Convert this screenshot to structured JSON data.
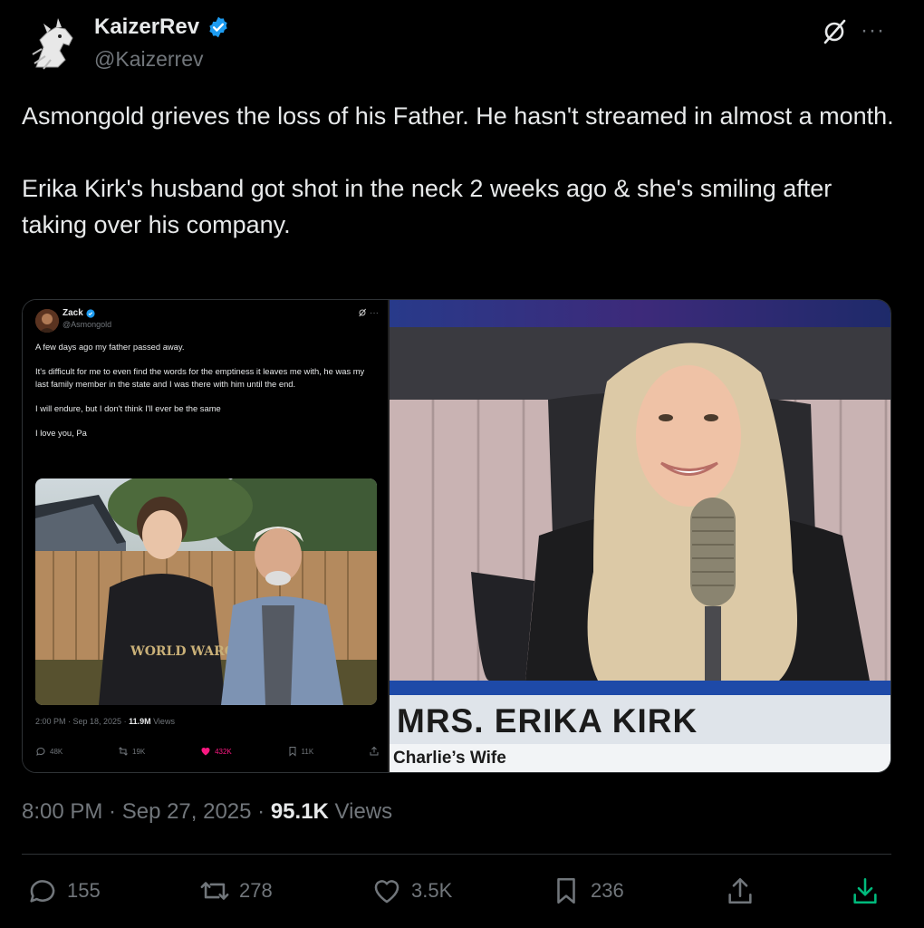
{
  "post": {
    "author": {
      "display_name": "KaizerRev",
      "handle": "@Kaizerrev",
      "verified": true,
      "avatar_icon": "horse-head-sketch-avatar"
    },
    "text_paragraphs": [
      "Asmongold grieves the loss of his Father. He hasn't streamed in almost a month.",
      "Erika Kirk's husband got shot in the neck 2 weeks ago & she's smiling after taking over his company."
    ],
    "timestamp": "8:00 PM · Sep 27, 2025 · ",
    "views_count": "95.1K",
    "views_label": " Views",
    "actions": {
      "replies": "155",
      "reposts": "278",
      "likes": "3.5K",
      "bookmarks": "236"
    },
    "colors": {
      "verified": "#1d9bf0",
      "muted": "#71767b",
      "download": "#00ba7c",
      "like": "#f91880"
    }
  },
  "embedded_tweet": {
    "display_name": "Zack",
    "handle": "@Asmongold",
    "paragraphs": [
      "A few days ago my father passed away.",
      "It's difficult for me to even find the words for the emptiness it leaves me with, he was my last family member in the state and I was there with him until the end.",
      "I will endure, but I don't think I'll ever be the same",
      "I love you, Pa"
    ],
    "meta_time": "2:00 PM · Sep 18, 2025 · ",
    "meta_views": "11.9M",
    "meta_views_label": " Views",
    "photo_shirt_text": "WORLD WARCRAFT",
    "actions": {
      "replies": "48K",
      "reposts": "19K",
      "likes": "432K",
      "bookmarks": "11K"
    }
  },
  "screenshot_caption": {
    "title": "MRS. ERIKA KIRK",
    "subtitle": "Charlie’s Wife"
  }
}
